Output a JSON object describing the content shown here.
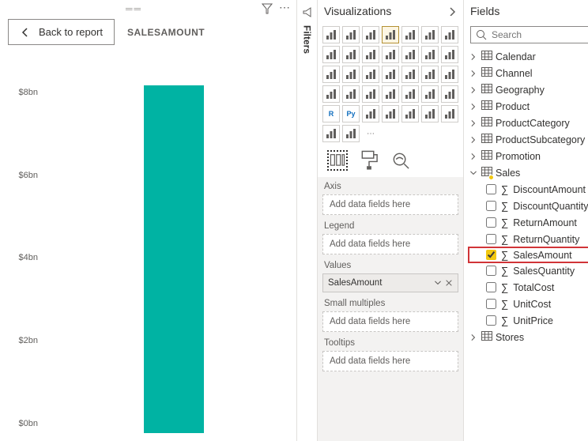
{
  "report": {
    "back_label": "Back to report",
    "title": "SALESAMOUNT"
  },
  "chart_data": {
    "type": "bar",
    "categories": [
      "SalesAmount"
    ],
    "values": [
      8.4
    ],
    "title": "SALESAMOUNT",
    "xlabel": "",
    "ylabel": "",
    "ylim": [
      0,
      8.8
    ],
    "y_ticks": [
      "$0bn",
      "$2bn",
      "$4bn",
      "$6bn",
      "$8bn"
    ],
    "unit": "bn USD"
  },
  "filters": {
    "label": "Filters"
  },
  "viz": {
    "header": "Visualizations",
    "icons": [
      "stacked-bar",
      "stacked-column",
      "clustered-bar",
      "clustered-column",
      "hundred-stacked-bar",
      "hundred-stacked-column",
      "line",
      "area",
      "stacked-area",
      "line-stacked-column",
      "line-clustered-column",
      "ribbon",
      "waterfall",
      "funnel",
      "scatter",
      "pie",
      "donut",
      "treemap",
      "map",
      "filled-map",
      "azure-map",
      "gauge",
      "card",
      "multi-row-card",
      "kpi",
      "slicer",
      "table",
      "matrix",
      "r-visual",
      "python-visual",
      "key-influencers",
      "decomposition-tree",
      "qna",
      "smart-narrative",
      "paginated",
      "power-apps",
      "power-automate",
      "more"
    ],
    "selected_icon": "clustered-column",
    "wells": {
      "axis": {
        "label": "Axis",
        "placeholder": "Add data fields here"
      },
      "legend": {
        "label": "Legend",
        "placeholder": "Add data fields here"
      },
      "values": {
        "label": "Values",
        "item": "SalesAmount"
      },
      "small_multiples": {
        "label": "Small multiples",
        "placeholder": "Add data fields here"
      },
      "tooltips": {
        "label": "Tooltips",
        "placeholder": "Add data fields here"
      }
    }
  },
  "fields": {
    "header": "Fields",
    "search_placeholder": "Search",
    "tables": [
      {
        "name": "Calendar",
        "expanded": false
      },
      {
        "name": "Channel",
        "expanded": false
      },
      {
        "name": "Geography",
        "expanded": false
      },
      {
        "name": "Product",
        "expanded": false
      },
      {
        "name": "ProductCategory",
        "expanded": false
      },
      {
        "name": "ProductSubcategory",
        "expanded": false
      },
      {
        "name": "Promotion",
        "expanded": false
      },
      {
        "name": "Sales",
        "expanded": true,
        "has_badge": true,
        "columns": [
          {
            "name": "DiscountAmount",
            "checked": false
          },
          {
            "name": "DiscountQuantity",
            "checked": false
          },
          {
            "name": "ReturnAmount",
            "checked": false
          },
          {
            "name": "ReturnQuantity",
            "checked": false
          },
          {
            "name": "SalesAmount",
            "checked": true,
            "highlight": true
          },
          {
            "name": "SalesQuantity",
            "checked": false
          },
          {
            "name": "TotalCost",
            "checked": false
          },
          {
            "name": "UnitCost",
            "checked": false
          },
          {
            "name": "UnitPrice",
            "checked": false
          }
        ]
      },
      {
        "name": "Stores",
        "expanded": false
      }
    ]
  }
}
